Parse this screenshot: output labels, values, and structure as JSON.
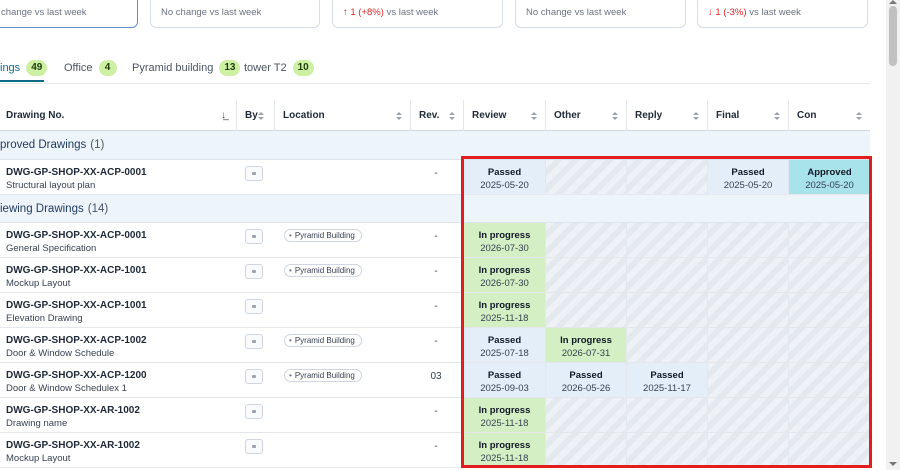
{
  "stat_cards": [
    {
      "trend": "",
      "text": "change vs last week"
    },
    {
      "trend": "",
      "text": "No change vs last week"
    },
    {
      "trend": "↑ 1 (+8%)",
      "text": "vs last week"
    },
    {
      "trend": "",
      "text": "No change vs last week"
    },
    {
      "trend": "↓ 1 (-3%)",
      "text": "vs last week"
    }
  ],
  "tabs": [
    {
      "label": "ings",
      "count": "49"
    },
    {
      "label": "Office",
      "count": "4"
    },
    {
      "label": "Pyramid building",
      "count": "13"
    },
    {
      "label": "tower T2",
      "count": "10"
    }
  ],
  "columns": {
    "drawing_no": "Drawing No.",
    "by": "By",
    "location": "Location",
    "rev": "Rev.",
    "review": "Review",
    "other": "Other",
    "reply": "Reply",
    "final": "Final",
    "con": "Con"
  },
  "groups": [
    {
      "title": "proved Drawings",
      "count": "(1)"
    },
    {
      "title": "iewing Drawings",
      "count": "(14)"
    }
  ],
  "rows": [
    {
      "code": "DWG-GP-SHOP-XX-ACP-0001",
      "desc": "Structural layout plan",
      "location": "",
      "rev": "-",
      "review": {
        "status": "Passed",
        "date": "2025-05-20",
        "kind": "passed"
      },
      "other": {
        "status": "",
        "date": "",
        "kind": "empty"
      },
      "reply": {
        "status": "",
        "date": "",
        "kind": "empty"
      },
      "final": {
        "status": "Passed",
        "date": "2025-05-20",
        "kind": "passed"
      },
      "con": {
        "status": "Approved",
        "date": "2025-05-20",
        "kind": "approved"
      }
    },
    {
      "code": "DWG-GP-SHOP-XX-ACP-0001",
      "desc": "General Specification",
      "location": "Pyramid Building",
      "rev": "-",
      "review": {
        "status": "In progress",
        "date": "2026-07-30",
        "kind": "progress"
      },
      "other": {
        "status": "",
        "date": "",
        "kind": "empty"
      },
      "reply": {
        "status": "",
        "date": "",
        "kind": "empty"
      },
      "final": {
        "status": "",
        "date": "",
        "kind": "empty"
      },
      "con": {
        "status": "",
        "date": "",
        "kind": "empty"
      }
    },
    {
      "code": "DWG-GP-SHOP-XX-ACP-1001",
      "desc": "Mockup Layout",
      "location": "Pyramid Building",
      "rev": "-",
      "review": {
        "status": "In progress",
        "date": "2026-07-30",
        "kind": "progress"
      },
      "other": {
        "status": "",
        "date": "",
        "kind": "empty"
      },
      "reply": {
        "status": "",
        "date": "",
        "kind": "empty"
      },
      "final": {
        "status": "",
        "date": "",
        "kind": "empty"
      },
      "con": {
        "status": "",
        "date": "",
        "kind": "empty"
      }
    },
    {
      "code": "DWG-GP-SHOP-XX-ACP-1001",
      "desc": "Elevation Drawing",
      "location": "",
      "rev": "-",
      "review": {
        "status": "In progress",
        "date": "2025-11-18",
        "kind": "progress"
      },
      "other": {
        "status": "",
        "date": "",
        "kind": "empty"
      },
      "reply": {
        "status": "",
        "date": "",
        "kind": "empty"
      },
      "final": {
        "status": "",
        "date": "",
        "kind": "empty"
      },
      "con": {
        "status": "",
        "date": "",
        "kind": "empty"
      }
    },
    {
      "code": "DWG-GP-SHOP-XX-ACP-1002",
      "desc": "Door & Window Schedule",
      "location": "Pyramid Building",
      "rev": "-",
      "review": {
        "status": "Passed",
        "date": "2025-07-18",
        "kind": "passed"
      },
      "other": {
        "status": "In progress",
        "date": "2026-07-31",
        "kind": "progress"
      },
      "reply": {
        "status": "",
        "date": "",
        "kind": "empty"
      },
      "final": {
        "status": "",
        "date": "",
        "kind": "empty"
      },
      "con": {
        "status": "",
        "date": "",
        "kind": "empty"
      }
    },
    {
      "code": "DWG-GP-SHOP-XX-ACP-1200",
      "desc": "Door & Window Schedulex 1",
      "location": "Pyramid Building",
      "rev": "03",
      "review": {
        "status": "Passed",
        "date": "2025-09-03",
        "kind": "passed"
      },
      "other": {
        "status": "Passed",
        "date": "2026-05-26",
        "kind": "passed"
      },
      "reply": {
        "status": "Passed",
        "date": "2025-11-17",
        "kind": "passed"
      },
      "final": {
        "status": "",
        "date": "",
        "kind": "empty"
      },
      "con": {
        "status": "",
        "date": "",
        "kind": "empty"
      }
    },
    {
      "code": "DWG-GP-SHOP-XX-AR-1002",
      "desc": "Drawing name",
      "location": "",
      "rev": "-",
      "review": {
        "status": "In progress",
        "date": "2025-11-18",
        "kind": "progress"
      },
      "other": {
        "status": "",
        "date": "",
        "kind": "empty"
      },
      "reply": {
        "status": "",
        "date": "",
        "kind": "empty"
      },
      "final": {
        "status": "",
        "date": "",
        "kind": "empty"
      },
      "con": {
        "status": "",
        "date": "",
        "kind": "empty"
      }
    },
    {
      "code": "DWG-GP-SHOP-XX-AR-1002",
      "desc": "Mockup Layout",
      "location": "",
      "rev": "-",
      "review": {
        "status": "In progress",
        "date": "2025-11-18",
        "kind": "progress"
      },
      "other": {
        "status": "",
        "date": "",
        "kind": "empty"
      },
      "reply": {
        "status": "",
        "date": "",
        "kind": "empty"
      },
      "final": {
        "status": "",
        "date": "",
        "kind": "empty"
      },
      "con": {
        "status": "",
        "date": "",
        "kind": "empty"
      }
    }
  ],
  "colors": {
    "passed": "#e3eef8",
    "in_progress": "#d4efc4",
    "approved": "#a8e3e9",
    "highlight": "#e11d1d",
    "badge": "#cdf0a3"
  }
}
